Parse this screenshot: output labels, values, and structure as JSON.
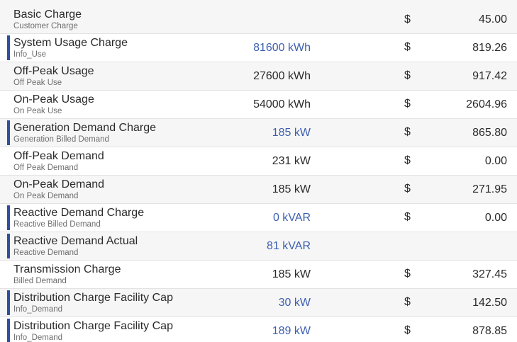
{
  "rows": [
    {
      "name": "Basic Charge",
      "sub": "Customer Charge",
      "qty": "",
      "qty_link": false,
      "accent": false,
      "currency": "$",
      "amount": "45.00"
    },
    {
      "name": "System Usage Charge",
      "sub": "Info_Use",
      "qty": "81600 kWh",
      "qty_link": true,
      "accent": true,
      "currency": "$",
      "amount": "819.26"
    },
    {
      "name": "Off-Peak Usage",
      "sub": "Off Peak Use",
      "qty": "27600 kWh",
      "qty_link": false,
      "accent": false,
      "currency": "$",
      "amount": "917.42"
    },
    {
      "name": "On-Peak Usage",
      "sub": "On Peak Use",
      "qty": "54000 kWh",
      "qty_link": false,
      "accent": false,
      "currency": "$",
      "amount": "2604.96"
    },
    {
      "name": "Generation Demand Charge",
      "sub": "Generation Billed Demand",
      "qty": "185 kW",
      "qty_link": true,
      "accent": true,
      "currency": "$",
      "amount": "865.80"
    },
    {
      "name": "Off-Peak Demand",
      "sub": "Off Peak Demand",
      "qty": "231 kW",
      "qty_link": false,
      "accent": false,
      "currency": "$",
      "amount": "0.00"
    },
    {
      "name": "On-Peak Demand",
      "sub": "On Peak Demand",
      "qty": "185 kW",
      "qty_link": false,
      "accent": false,
      "currency": "$",
      "amount": "271.95"
    },
    {
      "name": "Reactive Demand Charge",
      "sub": "Reactive Billed Demand",
      "qty": "0 kVAR",
      "qty_link": true,
      "accent": true,
      "currency": "$",
      "amount": "0.00"
    },
    {
      "name": "Reactive Demand Actual",
      "sub": "Reactive Demand",
      "qty": "81 kVAR",
      "qty_link": true,
      "accent": true,
      "currency": "",
      "amount": ""
    },
    {
      "name": "Transmission Charge",
      "sub": "Billed Demand",
      "qty": "185 kW",
      "qty_link": false,
      "accent": false,
      "currency": "$",
      "amount": "327.45"
    },
    {
      "name": "Distribution Charge Facility Cap",
      "sub": "Info_Demand",
      "qty": "30 kW",
      "qty_link": true,
      "accent": true,
      "currency": "$",
      "amount": "142.50"
    },
    {
      "name": "Distribution Charge Facility Cap",
      "sub": "Info_Demand",
      "qty": "189 kW",
      "qty_link": true,
      "accent": true,
      "currency": "$",
      "amount": "878.85"
    }
  ],
  "colors": {
    "accent": "#2f4f9f",
    "link": "#3d5fb0",
    "row_alt": "#f6f6f6"
  }
}
